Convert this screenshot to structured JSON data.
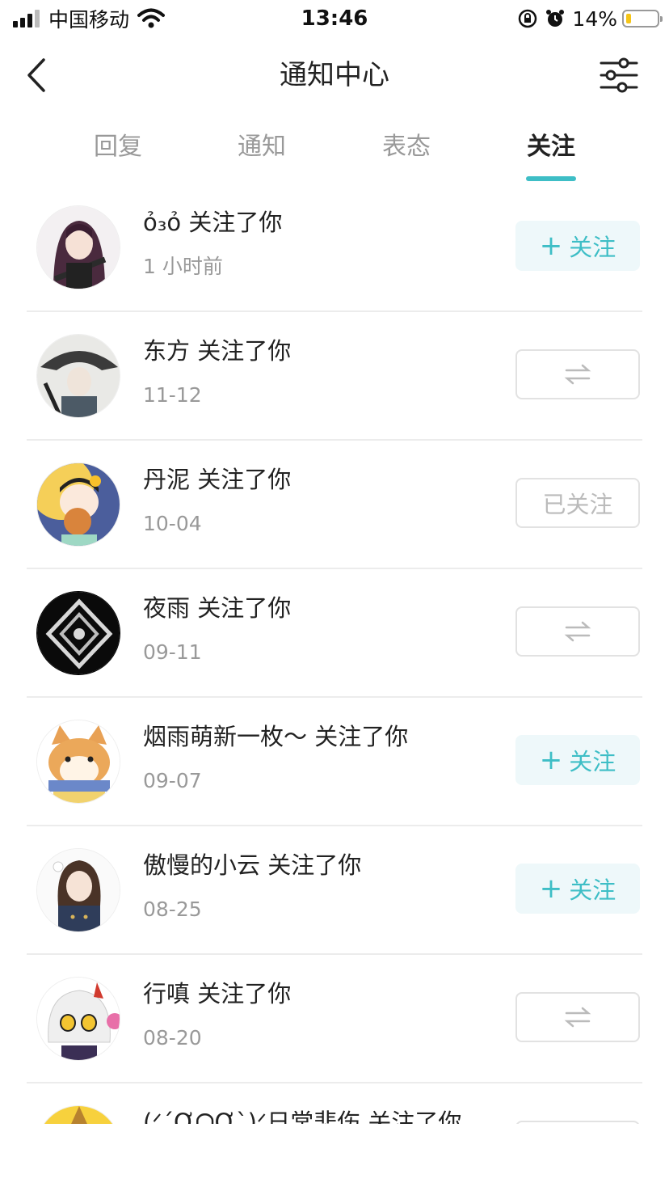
{
  "status_bar": {
    "carrier": "中国移动",
    "time": "13:46",
    "battery": "14%"
  },
  "nav": {
    "title": "通知中心"
  },
  "tabs": [
    {
      "label": "回复",
      "active": false
    },
    {
      "label": "通知",
      "active": false
    },
    {
      "label": "表态",
      "active": false
    },
    {
      "label": "关注",
      "active": true
    }
  ],
  "list": [
    {
      "name": "ỏ₃ỏ 关注了你",
      "time": "1 小时前",
      "button": "follow",
      "button_label": "关注"
    },
    {
      "name": "东方 关注了你",
      "time": "11-12",
      "button": "mutual",
      "button_label": "⇄"
    },
    {
      "name": "丹泥 关注了你",
      "time": "10-04",
      "button": "followed",
      "button_label": "已关注"
    },
    {
      "name": "夜雨 关注了你",
      "time": "09-11",
      "button": "mutual",
      "button_label": "⇄"
    },
    {
      "name": "烟雨萌新一枚～ 关注了你",
      "time": "09-07",
      "button": "follow",
      "button_label": "关注"
    },
    {
      "name": "傲慢的小云 关注了你",
      "time": "08-25",
      "button": "follow",
      "button_label": "关注"
    },
    {
      "name": "行嗔 关注了你",
      "time": "08-20",
      "button": "mutual",
      "button_label": "⇄"
    },
    {
      "name": "(ᐟ´ỢᗝỢ`)ᐟ日常悲伤 关注了你",
      "time": "",
      "button": "mutual",
      "button_label": "⇄"
    }
  ],
  "colors": {
    "accent": "#3ebec6",
    "follow_bg": "#eef8fa",
    "divider": "#ececec",
    "muted_text": "#999999"
  }
}
